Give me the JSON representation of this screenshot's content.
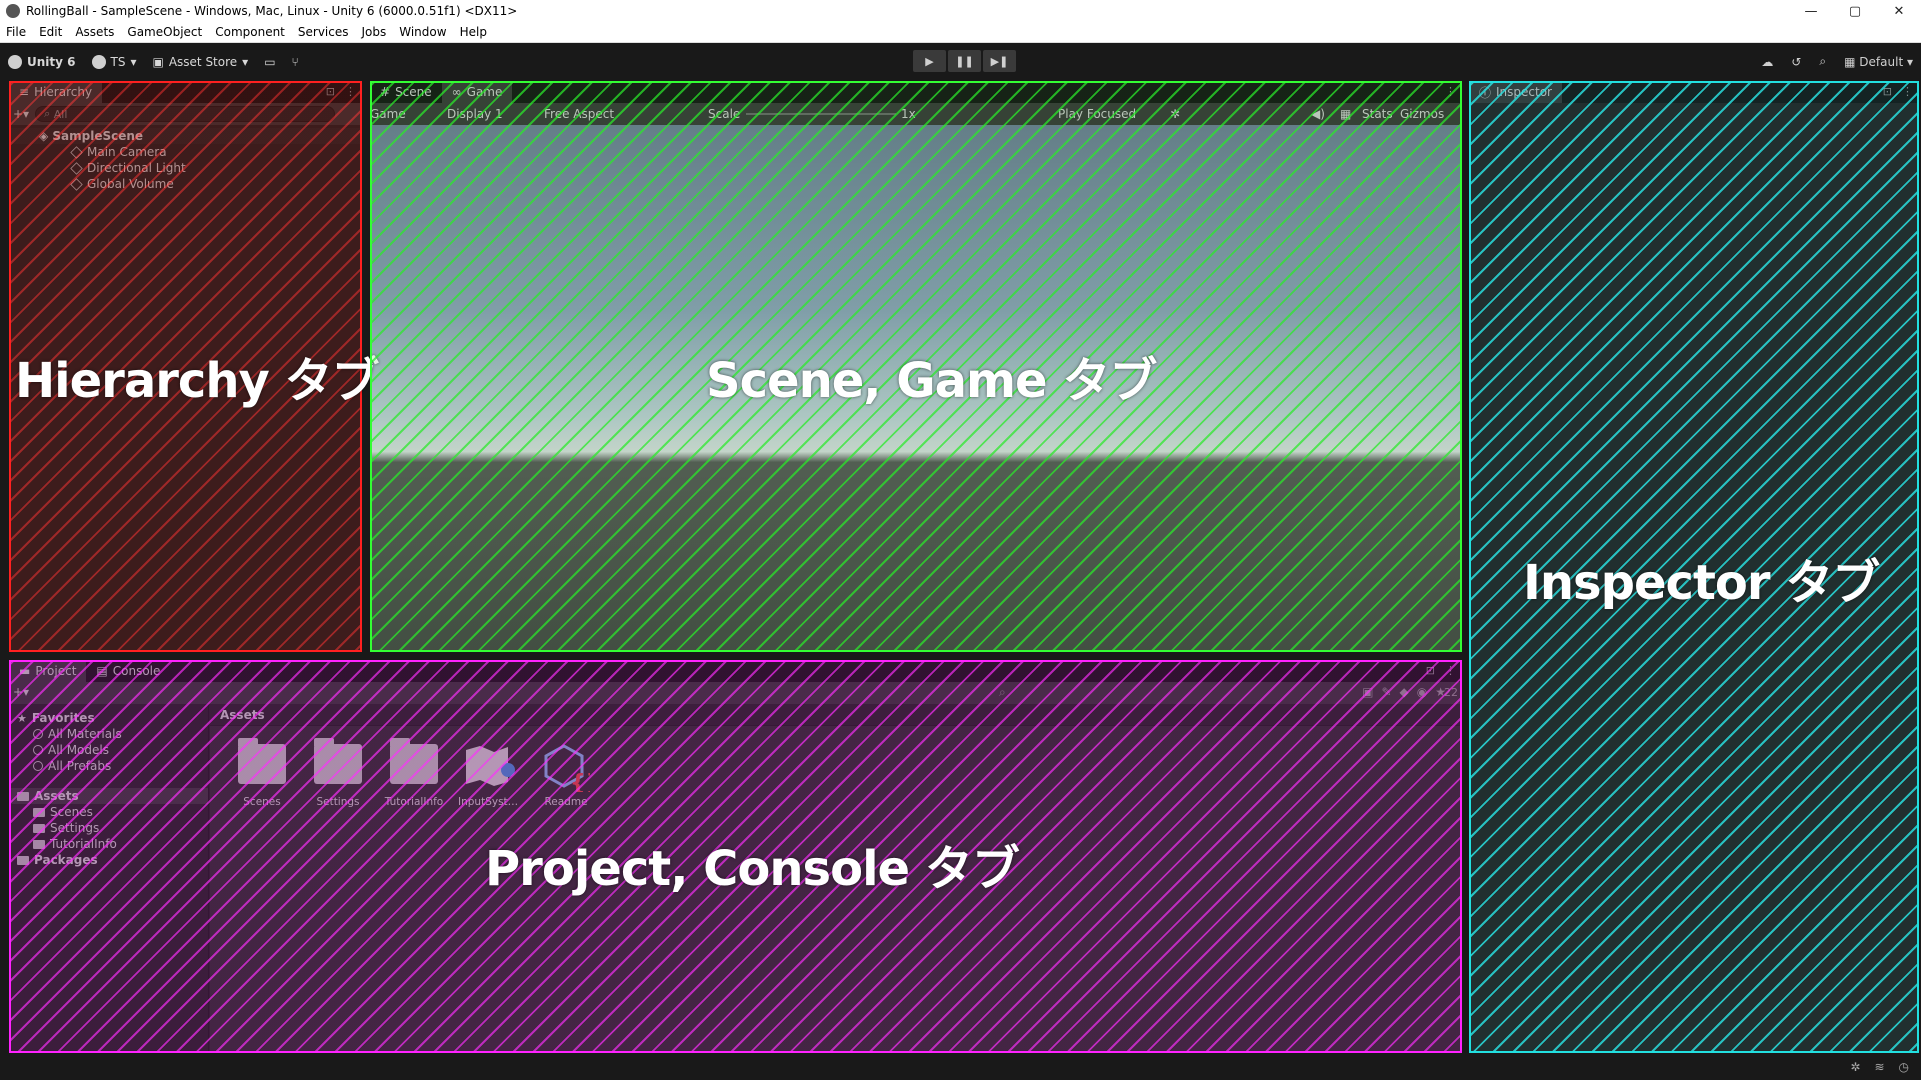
{
  "window": {
    "title": "RollingBall - SampleScene - Windows, Mac, Linux - Unity 6 (6000.0.51f1) <DX11>",
    "controls": [
      "—",
      "▢",
      "✕"
    ]
  },
  "menubar": [
    "File",
    "Edit",
    "Assets",
    "GameObject",
    "Component",
    "Services",
    "Jobs",
    "Window",
    "Help"
  ],
  "toolbar": {
    "unity_label": "Unity 6",
    "account_label": "TS",
    "asset_store_label": "Asset Store",
    "layout_label": "Default",
    "play": "▶",
    "pause": "❚❚",
    "step": "▶❚"
  },
  "hierarchy": {
    "tab": "Hierarchy",
    "search_placeholder": "All",
    "scene": "SampleScene",
    "children": [
      "Main Camera",
      "Directional Light",
      "Global Volume"
    ]
  },
  "game_panel": {
    "tabs": [
      "Scene",
      "Game"
    ],
    "mode": "Game",
    "display": "Display 1",
    "aspect": "Free Aspect",
    "scale_label": "Scale",
    "scale_value": "1x",
    "play_focused": "Play Focused",
    "stats": "Stats",
    "gizmos": "Gizmos"
  },
  "inspector": {
    "tab": "Inspector"
  },
  "project": {
    "tabs": [
      "Project",
      "Console"
    ],
    "favorites": "Favorites",
    "favorite_items": [
      "All Materials",
      "All Models",
      "All Prefabs"
    ],
    "assets_root": "Assets",
    "asset_folders": [
      "Scenes",
      "Settings",
      "TutorialInfo"
    ],
    "packages": "Packages",
    "breadcrumb": "Assets",
    "grid_items": [
      "Scenes",
      "Settings",
      "TutorialInfo",
      "InputSyste...",
      "Readme"
    ],
    "count": "22"
  },
  "overlays": {
    "hierarchy": "Hierarchy タブ",
    "scene_game": "Scene, Game タブ",
    "inspector": "Inspector タブ",
    "project_console": "Project, Console タブ"
  },
  "colors": {
    "hierarchy_overlay": "#ff2020",
    "scene_overlay": "#33ff33",
    "inspector_overlay": "#22e0e0",
    "project_overlay": "#ff22ff"
  }
}
